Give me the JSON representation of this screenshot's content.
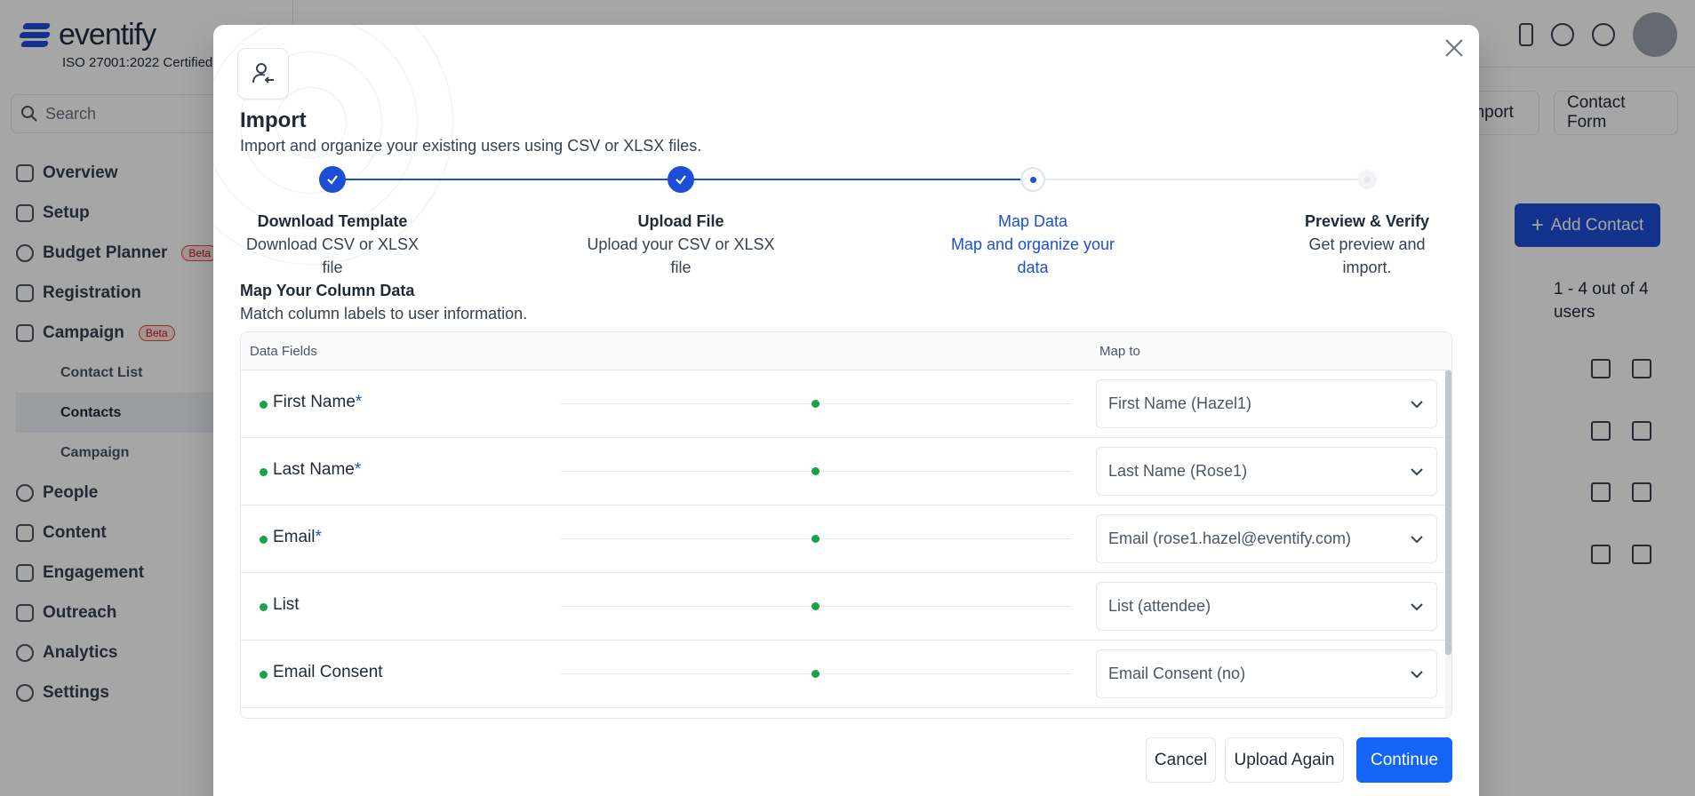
{
  "app": {
    "logo_text": "eventify",
    "certification": "ISO 27001:2022 Certified",
    "search_placeholder": "Search",
    "nav": [
      {
        "label": "Overview"
      },
      {
        "label": "Setup"
      },
      {
        "label": "Budget Planner",
        "badge": "Beta"
      },
      {
        "label": "Registration"
      },
      {
        "label": "Campaign",
        "badge": "Beta"
      }
    ],
    "campaign_sub": [
      {
        "label": "Contact List",
        "active": false
      },
      {
        "label": "Contacts",
        "active": true
      },
      {
        "label": "Campaign",
        "active": false
      }
    ],
    "nav_bottom": [
      {
        "label": "People"
      },
      {
        "label": "Content"
      },
      {
        "label": "Engagement"
      },
      {
        "label": "Outreach"
      },
      {
        "label": "Analytics"
      },
      {
        "label": "Settings"
      }
    ],
    "header_buttons": {
      "import": "Import",
      "contact_form": "Contact Form"
    },
    "add_contact": "Add Contact",
    "count_text": "1 - 4 out of 4 users"
  },
  "modal": {
    "title": "Import",
    "subtitle": "Import and organize your existing users using CSV or XLSX files.",
    "steps": [
      {
        "title": "Download Template",
        "desc": "Download CSV or XLSX file",
        "status": "complete"
      },
      {
        "title": "Upload File",
        "desc": "Upload your CSV or XLSX file",
        "status": "complete"
      },
      {
        "title": "Map Data",
        "desc": "Map and organize your data",
        "status": "current"
      },
      {
        "title": "Preview & Verify",
        "desc": "Get preview and import.",
        "status": "upcoming"
      }
    ],
    "map_title": "Map Your Column Data",
    "map_subtitle": "Match column labels to user information.",
    "table_headers": {
      "fields": "Data Fields",
      "map_to": "Map to"
    },
    "rows": [
      {
        "field": "First Name",
        "required": true,
        "mapped": "First Name (Hazel1)"
      },
      {
        "field": "Last Name",
        "required": true,
        "mapped": "Last Name (Rose1)"
      },
      {
        "field": "Email",
        "required": true,
        "mapped": "Email (rose1.hazel@eventify.com)"
      },
      {
        "field": "List",
        "required": false,
        "mapped": "List (attendee)"
      },
      {
        "field": "Email Consent",
        "required": false,
        "mapped": "Email Consent (no)"
      }
    ],
    "buttons": {
      "cancel": "Cancel",
      "upload_again": "Upload Again",
      "continue": "Continue"
    }
  },
  "colors": {
    "primary": "#1464f6",
    "success": "#16a34a",
    "step_active": "#1d4ed8"
  }
}
